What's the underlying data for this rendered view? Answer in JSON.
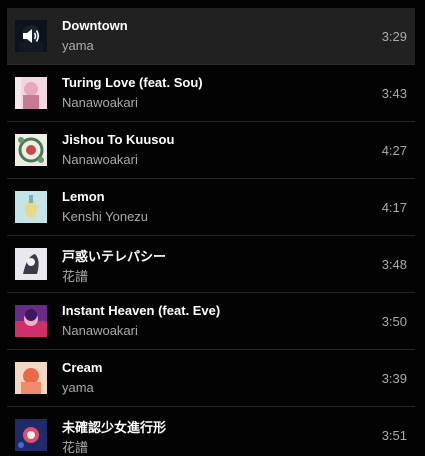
{
  "queue": {
    "tracks": [
      {
        "title": "Downtown",
        "artist": "yama",
        "duration": "3:29",
        "playing": true,
        "art_color": "#1e2a3a",
        "art_icon": "speaker-icon"
      },
      {
        "title": "Turing Love (feat. Sou)",
        "artist": "Nanawoakari",
        "duration": "3:43",
        "playing": false,
        "art_color": "#e8b4c8"
      },
      {
        "title": "Jishou To Kuusou",
        "artist": "Nanawoakari",
        "duration": "4:27",
        "playing": false,
        "art_color": "#4a7a5a"
      },
      {
        "title": "Lemon",
        "artist": "Kenshi Yonezu",
        "duration": "4:17",
        "playing": false,
        "art_color": "#b8dce0"
      },
      {
        "title": "戸惑いテレパシー",
        "artist": "花譜",
        "duration": "3:48",
        "playing": false,
        "art_color": "#d0d0d8"
      },
      {
        "title": "Instant Heaven (feat. Eve)",
        "artist": "Nanawoakari",
        "duration": "3:50",
        "playing": false,
        "art_color": "#c03070"
      },
      {
        "title": "Cream",
        "artist": "yama",
        "duration": "3:39",
        "playing": false,
        "art_color": "#e86a4a"
      },
      {
        "title": "未確認少女進行形",
        "artist": "花譜",
        "duration": "3:51",
        "playing": false,
        "art_color": "#283a8a"
      }
    ]
  }
}
